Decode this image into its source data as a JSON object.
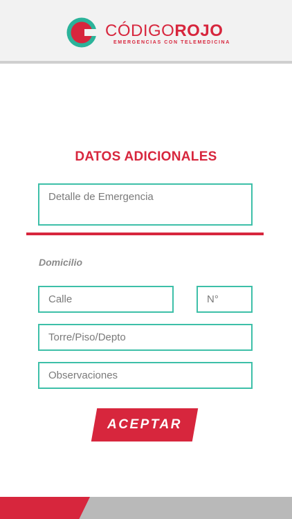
{
  "header": {
    "brand_part1": "CÓDIGO",
    "brand_part2": "ROJO",
    "tagline": "EMERGENCIAS CON TELEMEDICINA",
    "logo_icon": "codigo-rojo-logo-icon"
  },
  "form": {
    "title": "DATOS ADICIONALES",
    "emergency_detail_placeholder": "Detalle de Emergencia",
    "section_label": "Domicilio",
    "street_placeholder": "Calle",
    "number_placeholder": "N°",
    "tower_floor_placeholder": "Torre/Piso/Depto",
    "notes_placeholder": "Observaciones",
    "accept_label": "ACEPTAR"
  },
  "colors": {
    "brand_red": "#d7263d",
    "field_border_teal": "#3dbfa8",
    "header_gray": "#f2f2f2"
  }
}
